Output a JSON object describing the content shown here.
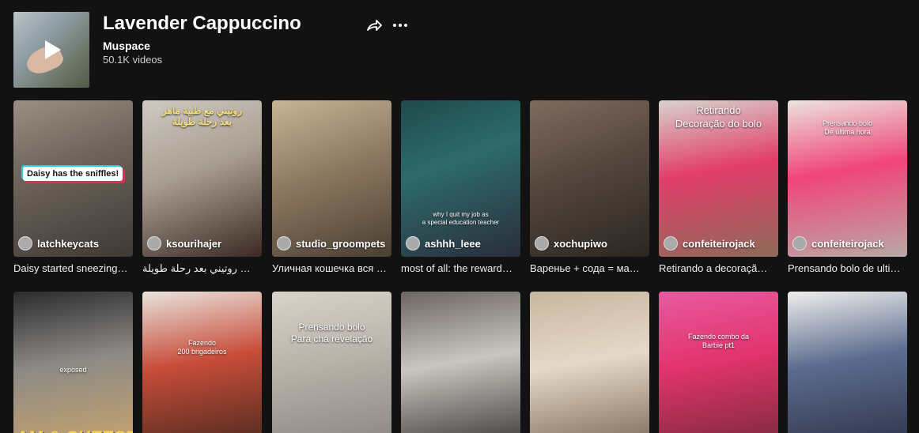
{
  "playlist": {
    "title": "Lavender Cappuccino",
    "creator": "Muspace",
    "video_count": "50.1K videos"
  },
  "icons": {
    "share": "share-icon",
    "more": "more-options-icon",
    "play": "play-icon"
  },
  "row1": [
    {
      "author": "latchkeycats",
      "caption": "Daisy started sneezing…",
      "overlay": "Daisy has the sniffles!",
      "bg": "linear-gradient(160deg,#9a8f83 0%,#6e655c 40%,#3f3934 100%)"
    },
    {
      "author": "ksourihajer",
      "caption": "روتيني بعد رحلة طويلة ✈️ 🧑🏻‍✈️ …",
      "overlay": "روتيني مع طبية ماهر\nبعد رحلة طويلة",
      "bg": "linear-gradient(160deg,#cfcac3 0%,#a89d90 45%,#3b2a23 100%)"
    },
    {
      "author": "studio_groompets",
      "caption": "Уличная кошечка вся …",
      "overlay": "",
      "bg": "linear-gradient(160deg,#c9b497 0%,#8e7a62 45%,#4a3e33 100%)"
    },
    {
      "author": "ashhh_leee",
      "caption": "most of all: the reward…",
      "overlay": "why I quit my job as\na special education teacher",
      "bg": "linear-gradient(160deg,#1f4a4c 0%,#2d6b6a 40%,#2a2d3c 100%)"
    },
    {
      "author": "xochupiwo",
      "caption": "Варенье + сода = ма…",
      "overlay": "",
      "bg": "linear-gradient(160deg,#7d6b5e 0%,#55463d 45%,#2b2622 100%)"
    },
    {
      "author": "confeiteirojack",
      "caption": "Retirando a decoraçã…",
      "overlay": "Retirando\nDecoração do bolo",
      "bg": "linear-gradient(170deg,#d9d3cc 0%,#e23d6a 45%,#8e6b59 100%)"
    },
    {
      "author": "confeiteirojack",
      "caption": "Prensando bolo de ulti…",
      "overlay": "Prensando bolo\nDe última hora",
      "bg": "linear-gradient(170deg,#ece4de 0%,#f0457a 45%,#b9a9a6 100%)"
    }
  ],
  "row2": [
    {
      "author": "",
      "caption": "",
      "overlay": "exposed",
      "big": "AM & CHEESE",
      "bg": "linear-gradient(170deg,#2b2b2e 0%,#8c8a86 45%,#c9a36b 100%)"
    },
    {
      "author": "",
      "caption": "",
      "overlay": "Fazendo\n200 brigadeiros",
      "big": "",
      "bg": "linear-gradient(170deg,#e9e4dd 0%,#c84c3a 45%,#4c2a1e 100%)"
    },
    {
      "author": "",
      "caption": "",
      "overlay": "Prensando bolo\nPara chá revelação",
      "big": "",
      "bg": "linear-gradient(170deg,#d9d2c8 0%,#b8b2aa 45%,#8b8680 100%)"
    },
    {
      "author": "",
      "caption": "",
      "overlay": "",
      "big": "",
      "bg": "linear-gradient(170deg,#6c6660 0%,#c9c5c0 45%,#3a3836 100%)"
    },
    {
      "author": "",
      "caption": "",
      "overlay": "",
      "big": "",
      "bg": "linear-gradient(170deg,#c7b6a0 0%,#e6d8c8 45%,#7b6a5a 100%)"
    },
    {
      "author": "",
      "caption": "",
      "overlay": "Fazendo combo da\nBarbie pt1",
      "big": "",
      "bg": "linear-gradient(170deg,#e85aa0 0%,#e2336d 45%,#7a2a3a 100%)"
    },
    {
      "author": "",
      "caption": "",
      "overlay": "",
      "big": "",
      "bg": "linear-gradient(170deg,#f0efed 0%,#5b6b8e 45%,#2f3348 100%)"
    }
  ]
}
